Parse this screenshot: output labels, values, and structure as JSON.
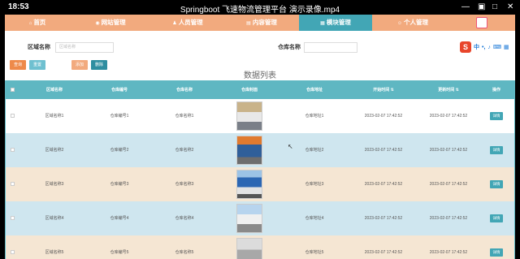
{
  "player": {
    "time": "18:53",
    "title": "Springboot 飞速物流管理平台 演示录像.mp4"
  },
  "colors": {
    "nav": "#f2aa7e",
    "nav_active": "#42a6b5",
    "table_header": "#5fb7c2",
    "row_a": "#ffffff",
    "row_b": "#cfe6ef",
    "row_c": "#f5e6d3"
  },
  "nav": {
    "items": [
      {
        "label": "首页",
        "icon": "home-icon"
      },
      {
        "label": "网站管理",
        "icon": "globe-icon"
      },
      {
        "label": "人员管理",
        "icon": "user-icon"
      },
      {
        "label": "内容管理",
        "icon": "document-icon"
      },
      {
        "label": "模块管理",
        "icon": "grid-icon"
      },
      {
        "label": "个人管理",
        "icon": "person-icon"
      }
    ]
  },
  "search": {
    "area_label": "区域名称",
    "area_placeholder": "区域名称",
    "warehouse_label": "仓库名称",
    "warehouse_placeholder": ""
  },
  "buttons": {
    "search": "查询",
    "reset": "重置",
    "add": "添加",
    "delete": "删除"
  },
  "list_title": "数据列表",
  "table": {
    "headers": [
      "区域名称",
      "仓库编号",
      "仓库名称",
      "仓库封面",
      "仓库地址",
      "开始时间 ⇅",
      "更新时间 ⇅",
      "操作"
    ],
    "rows": [
      {
        "area": "区域名称1",
        "code": "仓库编号1",
        "name": "仓库名称1",
        "address": "仓库地址1",
        "start": "2023-02-07 17:42:52",
        "update": "2023-02-07 17:42:52",
        "action": "详情"
      },
      {
        "area": "区域名称2",
        "code": "仓库编号2",
        "name": "仓库名称2",
        "address": "仓库地址2",
        "start": "2023-02-07 17:42:52",
        "update": "2023-02-07 17:42:52",
        "action": "详情"
      },
      {
        "area": "区域名称3",
        "code": "仓库编号3",
        "name": "仓库名称3",
        "address": "仓库地址3",
        "start": "2023-02-07 17:42:52",
        "update": "2023-02-07 17:42:52",
        "action": "详情"
      },
      {
        "area": "区域名称4",
        "code": "仓库编号4",
        "name": "仓库名称4",
        "address": "仓库地址4",
        "start": "2023-02-07 17:42:52",
        "update": "2023-02-07 17:42:52",
        "action": "详情"
      },
      {
        "area": "区域名称5",
        "code": "仓库编号5",
        "name": "仓库名称5",
        "address": "仓库地址5",
        "start": "2023-02-07 17:42:52",
        "update": "2023-02-07 17:42:52",
        "action": "详情"
      }
    ]
  }
}
